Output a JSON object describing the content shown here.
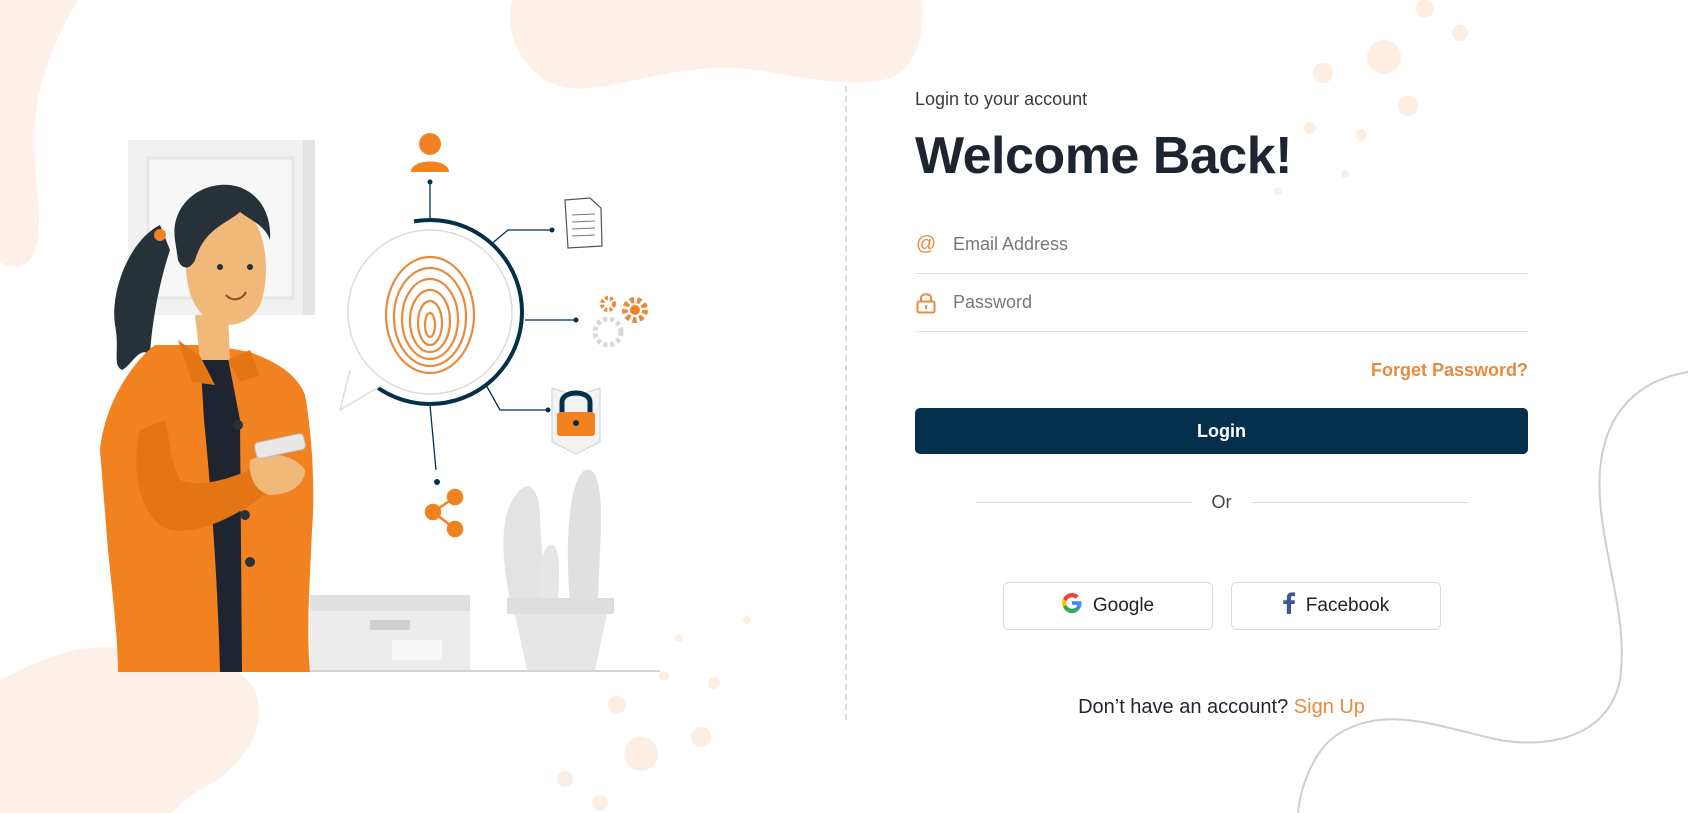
{
  "form": {
    "subtitle": "Login to your account",
    "title": "Welcome Back!",
    "email": {
      "icon": "at-sign-icon",
      "placeholder": "Email Address",
      "value": ""
    },
    "password": {
      "icon": "lock-icon",
      "placeholder": "Password",
      "value": ""
    },
    "forget_label": "Forget Password?",
    "login_label": "Login",
    "or_label": "Or",
    "social": {
      "google": {
        "icon": "google-icon",
        "label": "Google"
      },
      "facebook": {
        "icon": "facebook-icon",
        "label": "Facebook"
      }
    },
    "signup": {
      "prompt": "Don’t have an account?",
      "link": "Sign Up"
    }
  },
  "colors": {
    "accent": "#e98a3d",
    "primary": "#04304b",
    "blob": "#fdf0e8",
    "orange_jacket": "#f28220"
  }
}
